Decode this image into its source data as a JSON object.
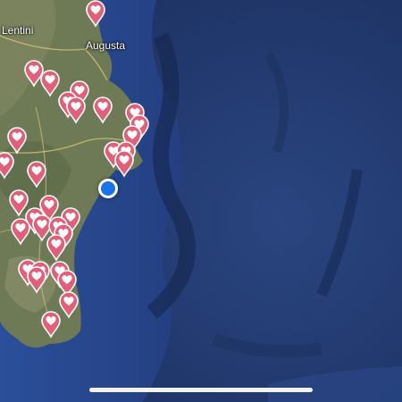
{
  "map": {
    "type": "satellite",
    "colors": {
      "sea": "#233a6e",
      "land": "#6d7a55",
      "pin": "#e0607a",
      "location": "#1a73e8"
    },
    "labels": {
      "lentini": "Lentini",
      "augusta": "Augusta"
    },
    "current_location": "blue-dot",
    "pin_icon": "heart-pin-icon"
  }
}
